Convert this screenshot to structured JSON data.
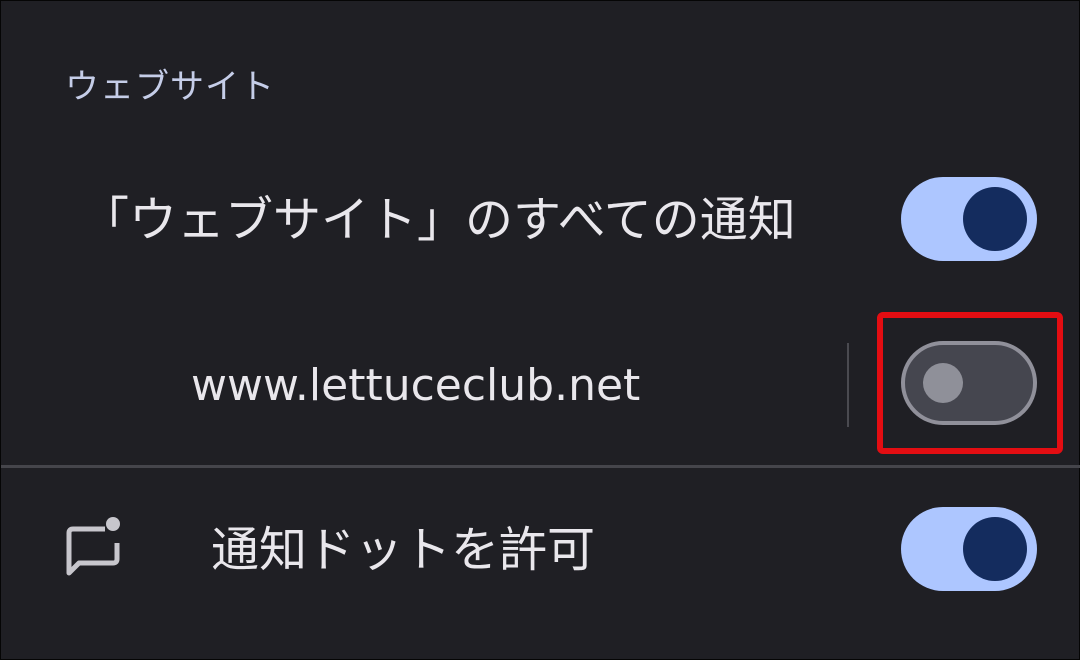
{
  "section": {
    "header": "ウェブサイト"
  },
  "all_notifications": {
    "label": "「ウェブサイト」のすべての通知",
    "state": "on"
  },
  "site": {
    "label": "www.lettuceclub.net",
    "state": "off"
  },
  "notification_dot": {
    "label": "通知ドットを許可",
    "icon": "notification-dot-icon",
    "state": "on"
  },
  "colors": {
    "background": "#1f1f24",
    "toggle_on_track": "#adc6ff",
    "toggle_on_knob": "#142c5e",
    "toggle_off_track": "#45464f",
    "highlight": "#e30d12"
  }
}
